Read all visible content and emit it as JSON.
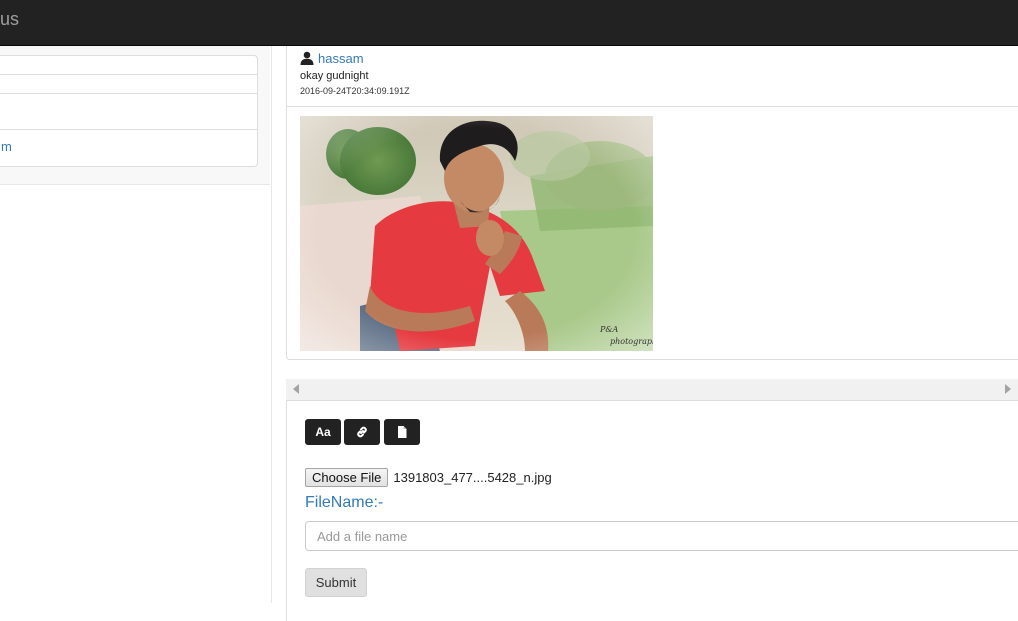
{
  "navbar": {
    "brand": "us"
  },
  "sidebar": {
    "items": [
      {
        "label": ""
      },
      {
        "label": ""
      },
      {
        "label": ""
      },
      {
        "label": "m"
      }
    ]
  },
  "post": {
    "username": "hassam",
    "text": "okay gudnight",
    "timestamp": "2016-09-24T20:34:09.191Z",
    "image_watermark_line1": "P&A",
    "image_watermark_line2": "photography"
  },
  "composer": {
    "tools": [
      {
        "label": "Aa",
        "icon": "font-icon"
      },
      {
        "label": "",
        "icon": "link-icon"
      },
      {
        "label": "",
        "icon": "file-icon"
      }
    ],
    "choose_file_label": "Choose File",
    "selected_file": "1391803_477....5428_n.jpg",
    "filename_label": "FileName:-",
    "filename_placeholder": "Add a file name",
    "filename_value": "",
    "submit_label": "Submit"
  },
  "colors": {
    "navbar_bg": "#222222",
    "link": "#337ab7",
    "toolbar_button": "#222222",
    "submit_bg": "#e0e0e0"
  }
}
